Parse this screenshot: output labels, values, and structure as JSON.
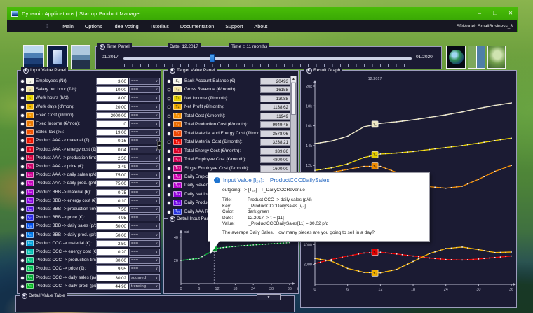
{
  "window": {
    "title": "Dynamic Applications | Startup Product Manager",
    "controls": {
      "minimize": "–",
      "maximize": "❐",
      "close": "✕"
    }
  },
  "menu": {
    "items": [
      "Main",
      "Options",
      "Idea Voting",
      "Tutorials",
      "Documentation",
      "Support",
      "About"
    ],
    "right_label": "SDModel: SmallBusiness_3"
  },
  "time_panel": {
    "legend": "Time Panel",
    "date_label": "Date: 12.2017",
    "time_label": "Time t: 11 months",
    "range_start": "01.2017",
    "range_end": "01.2020",
    "t": 11,
    "t_max": 36
  },
  "input_panel": {
    "legend": "Input Value Panel",
    "rows": [
      {
        "icon": "i₁",
        "color": "#f2f2e4",
        "dark": true,
        "label": "Employees (Nr):",
        "value": "3.00",
        "mode": "==="
      },
      {
        "icon": "i₂",
        "color": "#efe4a8",
        "dark": true,
        "label": "Salary per hour (€/h):",
        "value": "10.00",
        "mode": "==="
      },
      {
        "icon": "i₃",
        "color": "#e8d400",
        "dark": true,
        "label": "Work hours (h/d):",
        "value": "8.00",
        "mode": "==="
      },
      {
        "icon": "i₄",
        "color": "#f0b600",
        "dark": true,
        "label": "Work days (d/mon):",
        "value": "20.00",
        "mode": "==="
      },
      {
        "icon": "i₅",
        "color": "#f29600",
        "dark": false,
        "label": "Fixed Cost (€/mon):",
        "value": "2000.00",
        "mode": "==="
      },
      {
        "icon": "i₆",
        "color": "#ec7800",
        "dark": false,
        "label": "Fixed Income (€/mon):",
        "value": "0",
        "mode": "==="
      },
      {
        "icon": "i₇",
        "color": "#f25200",
        "dark": false,
        "label": "Sales Tax (%):",
        "value": "19.00",
        "mode": "==="
      },
      {
        "icon": "i₈",
        "color": "#ee1500",
        "dark": false,
        "label": "Product AAA -> material (€):",
        "value": "0.16",
        "mode": "==="
      },
      {
        "icon": "i₉",
        "color": "#e2001c",
        "dark": false,
        "label": "Product AAA -> energy cost (€):",
        "value": "0.04",
        "mode": "==="
      },
      {
        "icon": "i₁₀",
        "color": "#d60040",
        "dark": false,
        "label": "Product AAA -> production time (min",
        "value": "2.50",
        "mode": "==="
      },
      {
        "icon": "i₁₁",
        "color": "#cc0068",
        "dark": false,
        "label": "Product AAA -> price (€):",
        "value": "3.49",
        "mode": "==="
      },
      {
        "icon": "i₁₂",
        "color": "#cc0090",
        "dark": false,
        "label": "Product AAA -> daily sales (p/d):",
        "value": "75.00",
        "mode": "==="
      },
      {
        "icon": "i₁₃",
        "color": "#c400bd",
        "dark": false,
        "label": "Product AAA -> daily prod. (p/d):",
        "value": "75.00",
        "mode": "==="
      },
      {
        "icon": "i₁₄",
        "color": "#a800d4",
        "dark": false,
        "label": "Product BBB -> material (€):",
        "value": "0.75",
        "mode": "==="
      },
      {
        "icon": "i₁₅",
        "color": "#8a00e0",
        "dark": false,
        "label": "Product BBB -> energy cost (€):",
        "value": "0.10",
        "mode": "==="
      },
      {
        "icon": "i₁₆",
        "color": "#5a10e6",
        "dark": false,
        "label": "Product BBB -> production time (min",
        "value": "7.50",
        "mode": "==="
      },
      {
        "icon": "i₁₇",
        "color": "#2a2ae8",
        "dark": false,
        "label": "Product BBB -> price (€):",
        "value": "4.95",
        "mode": "==="
      },
      {
        "icon": "i₁₈",
        "color": "#0050ee",
        "dark": false,
        "label": "Product BBB -> daily sales (p/d):",
        "value": "50.00",
        "mode": "==="
      },
      {
        "icon": "i₁₉",
        "color": "#0078e8",
        "dark": false,
        "label": "Product BBB -> daily prod. (p/d):",
        "value": "50.00",
        "mode": "==="
      },
      {
        "icon": "i₂₀",
        "color": "#00a0d8",
        "dark": false,
        "label": "Product CCC -> material (€):",
        "value": "2.50",
        "mode": "==="
      },
      {
        "icon": "i₂₁",
        "color": "#00bcae",
        "dark": false,
        "label": "Product CCC -> energy cost (€):",
        "value": "0.20",
        "mode": "==="
      },
      {
        "icon": "i₂₂",
        "color": "#00c27c",
        "dark": false,
        "label": "Product CCC -> production time (min",
        "value": "30.00",
        "mode": "==="
      },
      {
        "icon": "i₂₃",
        "color": "#00bc50",
        "dark": false,
        "label": "Product CCC -> price (€):",
        "value": "9.95",
        "mode": "==="
      },
      {
        "icon": "i₂₄",
        "color": "#00a832",
        "dark": false,
        "label": "Product CCC -> daily sales (p/d):",
        "value": "30.02",
        "mode": "squared"
      },
      {
        "icon": "i₂₅",
        "color": "#00b81e",
        "dark": false,
        "label": "Product CCC -> daily prod. (p/d):",
        "value": "44.96",
        "mode": "trending"
      }
    ]
  },
  "target_panel": {
    "legend": "Target Value Panel",
    "rows": [
      {
        "icon": "S₁",
        "color": "#f4f4ec",
        "dark": true,
        "label": "Bank Account Balance (€):",
        "value": "20493",
        "selected": false
      },
      {
        "icon": "T₂",
        "color": "#f0e2a2",
        "dark": true,
        "label": "Gross Revenue (€/month):",
        "value": "16158",
        "selected": true
      },
      {
        "icon": "T₃",
        "color": "#e8d000",
        "dark": true,
        "label": "Net Income (€/month):",
        "value": "13088",
        "selected": true
      },
      {
        "icon": "T₄",
        "color": "#f0ac00",
        "dark": true,
        "label": "Net Profit (€/month):",
        "value": "1138.62",
        "selected": true
      },
      {
        "icon": "T₅",
        "color": "#f28c00",
        "dark": false,
        "label": "Total Cost (€/month):",
        "value": "11949",
        "selected": true
      },
      {
        "icon": "T₆",
        "color": "#ea6c00",
        "dark": false,
        "label": "Total Production Cost (€/month):",
        "value": "9949.48",
        "selected": false
      },
      {
        "icon": "T₇",
        "color": "#f04600",
        "dark": false,
        "label": "Total Material and Energy Cost (€/month):",
        "value": "3578.06",
        "selected": false
      },
      {
        "icon": "T₈",
        "color": "#ee0800",
        "dark": false,
        "label": "Total Material Cost (€/month):",
        "value": "3238.21",
        "selected": true
      },
      {
        "icon": "T₉",
        "color": "#dc0028",
        "dark": false,
        "label": "Total Energy Cost (€/month):",
        "value": "339.86",
        "selected": false
      },
      {
        "icon": "T₁₀",
        "color": "#d00052",
        "dark": false,
        "label": "Total Employee Cost (€/month):",
        "value": "4800.00",
        "selected": false
      },
      {
        "icon": "T₁₁",
        "color": "#cc0080",
        "dark": false,
        "label": "Single Employee Cost (€/month):",
        "value": "1600.00",
        "selected": false
      },
      {
        "icon": "T₁₂",
        "color": "#cc00ac",
        "dark": false,
        "label": "Daily Employee Cost (€/day):",
        "value": "",
        "selected": false
      },
      {
        "icon": "T₁₃",
        "color": "#b400cc",
        "dark": false,
        "label": "Daily Revenue (€/day):",
        "value": "",
        "selected": false
      },
      {
        "icon": "T₁₄",
        "color": "#9000d8",
        "dark": false,
        "label": "Daily Net Income (€/day):",
        "value": "",
        "selected": false
      },
      {
        "icon": "T₁₅",
        "color": "#6a00e0",
        "dark": false,
        "label": "Daily Production Cost (€/day):",
        "value": "",
        "selected": false
      },
      {
        "icon": "T₁₆",
        "color": "#2633e0",
        "dark": false,
        "label": "Daily AAA Revenue (€/day):",
        "value": "",
        "selected": false
      }
    ]
  },
  "detail_input_panel": {
    "legend": "Detail Input Panel"
  },
  "detail_value_table": {
    "legend": "Detail Value Table"
  },
  "result_graph": {
    "legend": "Result Graph"
  },
  "tooltip": {
    "header": "Input Value  [i₂₄]:  i_ProductCCCDailySales",
    "outgoing": "outgoing:  ->  [T₁₈] :  T_DailyCCCRevenue",
    "fields": [
      [
        "Title:",
        "Product CCC -> daily sales (p/d)"
      ],
      [
        "Key:",
        "i_ProductCCCDailySales  [i₂₄]"
      ],
      [
        "Color:",
        "dark green"
      ],
      [
        "Date:",
        "12.2017  ->  t = [11]"
      ],
      [
        "Value:",
        "i_ProductCCCDailySales[11] = 30.02 p/d"
      ]
    ],
    "description": "The average Daily Sales. How many pieces are you going to sell in a day?"
  },
  "chart_data": [
    {
      "id": "result",
      "type": "line",
      "annotation": "12.2017",
      "xlabel": "t",
      "xlim": [
        0,
        36
      ],
      "ylim": [
        0,
        20500
      ],
      "x": [
        0,
        3,
        6,
        9,
        12,
        15,
        18,
        21,
        24,
        27,
        30,
        33,
        36
      ],
      "x_ticks": [
        0,
        6,
        12,
        18,
        24,
        30,
        36
      ],
      "y_ticks": [
        {
          "text": "20k",
          "value": 20000
        },
        {
          "text": "18k",
          "value": 18000
        },
        {
          "text": "16k",
          "value": 16000
        },
        {
          "text": "14k",
          "value": 14000
        },
        {
          "text": "12k",
          "value": 12000
        },
        {
          "text": "4000",
          "value": 4000
        },
        {
          "text": "2000",
          "value": 2000
        }
      ],
      "marker_t": 11,
      "series": [
        {
          "name": "Gross Revenue",
          "marker_label": "T₂",
          "marker_value": 16158,
          "color": "#efe9c4",
          "values": [
            14200,
            14450,
            14950,
            15900,
            16250,
            16400,
            16600,
            16850,
            17100,
            17400,
            17750,
            18050,
            18300
          ]
        },
        {
          "name": "Net Income",
          "marker_label": "T₃",
          "marker_value": 13088,
          "color": "#e3cb00",
          "values": [
            11500,
            11750,
            12150,
            12800,
            13150,
            13250,
            13400,
            13600,
            13800,
            14000,
            14250,
            14500,
            14750
          ]
        },
        {
          "name": "Total Cost",
          "marker_label": "T₅",
          "marker_value": 11949,
          "color": "#ef8a00",
          "values": [
            11100,
            11300,
            11600,
            11900,
            11900,
            11300,
            10500,
            9850,
            9700,
            9900,
            10600,
            11400,
            12000
          ]
        },
        {
          "name": "Total Material Cost",
          "marker_label": "T₈",
          "marker_value": 3238.21,
          "color": "#e60000",
          "values": [
            2100,
            2500,
            2850,
            3150,
            3230,
            3050,
            2850,
            2650,
            2500,
            2450,
            2550,
            2700,
            2850
          ]
        },
        {
          "name": "Net Profit",
          "marker_label": "T₄",
          "marker_value": 1138.62,
          "color": "#f0ae00",
          "values": [
            2600,
            2350,
            1600,
            1200,
            1150,
            1500,
            2300,
            3100,
            3600,
            3750,
            3500,
            3200,
            3250
          ]
        }
      ]
    },
    {
      "id": "detail",
      "type": "line",
      "ylabel": "p/d",
      "xlabel": "t",
      "xlim": [
        0,
        36
      ],
      "ylim": [
        0,
        48
      ],
      "x": [
        0,
        6,
        12,
        18,
        24,
        30,
        36
      ],
      "x_ticks": [
        0,
        6,
        12,
        18,
        24,
        30,
        36
      ],
      "y_ticks": [
        {
          "text": "40",
          "value": 40
        },
        {
          "text": "20",
          "value": 20
        }
      ],
      "marker_t": 11,
      "series": [
        {
          "name": "i_ProductCCCDailySales",
          "marker_label": "i₂₄",
          "marker_value": 30.02,
          "color": "#00a531",
          "values": [
            20,
            21.8,
            30.6,
            32.2,
            33.4,
            34.4,
            35.4
          ]
        }
      ]
    }
  ]
}
